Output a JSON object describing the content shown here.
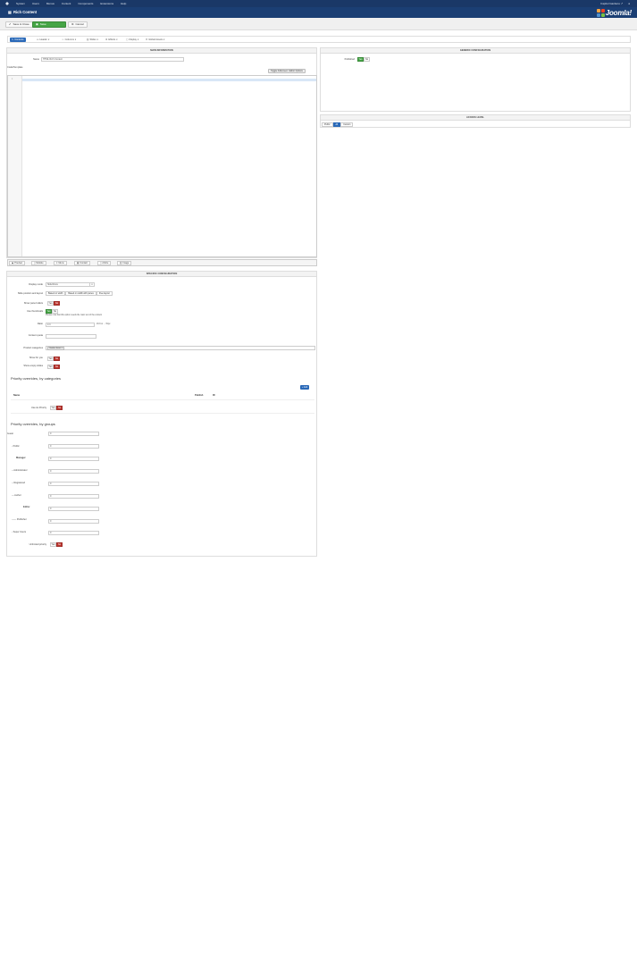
{
  "topnav": {
    "menu": [
      "System",
      "Users",
      "Menus",
      "Content",
      "Components",
      "Extensions",
      "Help"
    ],
    "site_label": "Capitol Gardens ↗",
    "user_icon": "user-icon"
  },
  "header": {
    "title": "Rich Content",
    "logo_text": "Joomla!"
  },
  "toolbar": {
    "save_close": "Save & Close",
    "save": "Save",
    "cancel": "Cancel"
  },
  "tabs": [
    {
      "label": "Contents"
    },
    {
      "label": "Header"
    },
    {
      "label": "Columns"
    },
    {
      "label": "Slides"
    },
    {
      "label": "Effects"
    },
    {
      "label": "Display"
    },
    {
      "label": "Global Assets"
    }
  ],
  "main": {
    "header": "MAIN INFORMATION",
    "name_label": "Name",
    "name_value": "HTML Rich Content",
    "text_label": "Code/Template",
    "editor_button": "Toggle Fullscreen / Editor Options",
    "line_number": "1"
  },
  "editbar": [
    "Preview",
    "Module",
    "Menu",
    "Contact",
    "Article",
    "Image"
  ],
  "generic": {
    "header": "GENERIC CONFIGURATION",
    "published_label": "Published",
    "yes": "Yes",
    "no": "No"
  },
  "access": {
    "header": "ACCESS LEVEL",
    "options": [
      "Public",
      "All",
      "Custom"
    ]
  },
  "specific": {
    "header": "SPECIFIC CONFIGURATION",
    "display_mode_label": "Display mode",
    "display_mode_value": "SlideShow",
    "layout_label": "Slide position and layout",
    "layout_options": [
      "Based on width",
      "Based on width with panes",
      "Free layout"
    ],
    "show_pane_label": "Show pane bullets",
    "use_pane_label": "Use thumbnails",
    "hint_text": "Please note that this option needs the main text of the content",
    "ratio_label": "Ratio",
    "ratio_value": "4:3",
    "ratio_suffix": "16:9 or ... %/px",
    "content_label": "Content quota",
    "category_label": "Product categories",
    "category_tag": "Garden Items ×",
    "cms_label": "Show for you",
    "display_label": "Show empty slides"
  },
  "categories": {
    "title": "Priority overrides, by categories",
    "add": "+ Add",
    "col_name": "Name",
    "col_publish": "Publish",
    "col_id": "ID",
    "row_label": "Use As Priority"
  },
  "groups": {
    "title": "Priority overrides, by groups",
    "items": [
      {
        "label": "Guest",
        "value": "0"
      },
      {
        "label": "- Public",
        "value": "0"
      },
      {
        "label": "Manager",
        "value": "0"
      },
      {
        "label": "-- Administrator",
        "value": "0"
      },
      {
        "label": "-- Registered",
        "value": "0"
      },
      {
        "label": "--- Author",
        "value": "0"
      },
      {
        "label": "Editor",
        "value": "0"
      },
      {
        "label": "------ Publisher",
        "value": "0"
      },
      {
        "label": "- Super Users",
        "value": "0"
      }
    ],
    "last_label": "Unlimited priority"
  },
  "colors": {
    "navy": "#1a3867",
    "blue": "#2a69b8",
    "green": "#46a546",
    "red": "#bd362f"
  }
}
